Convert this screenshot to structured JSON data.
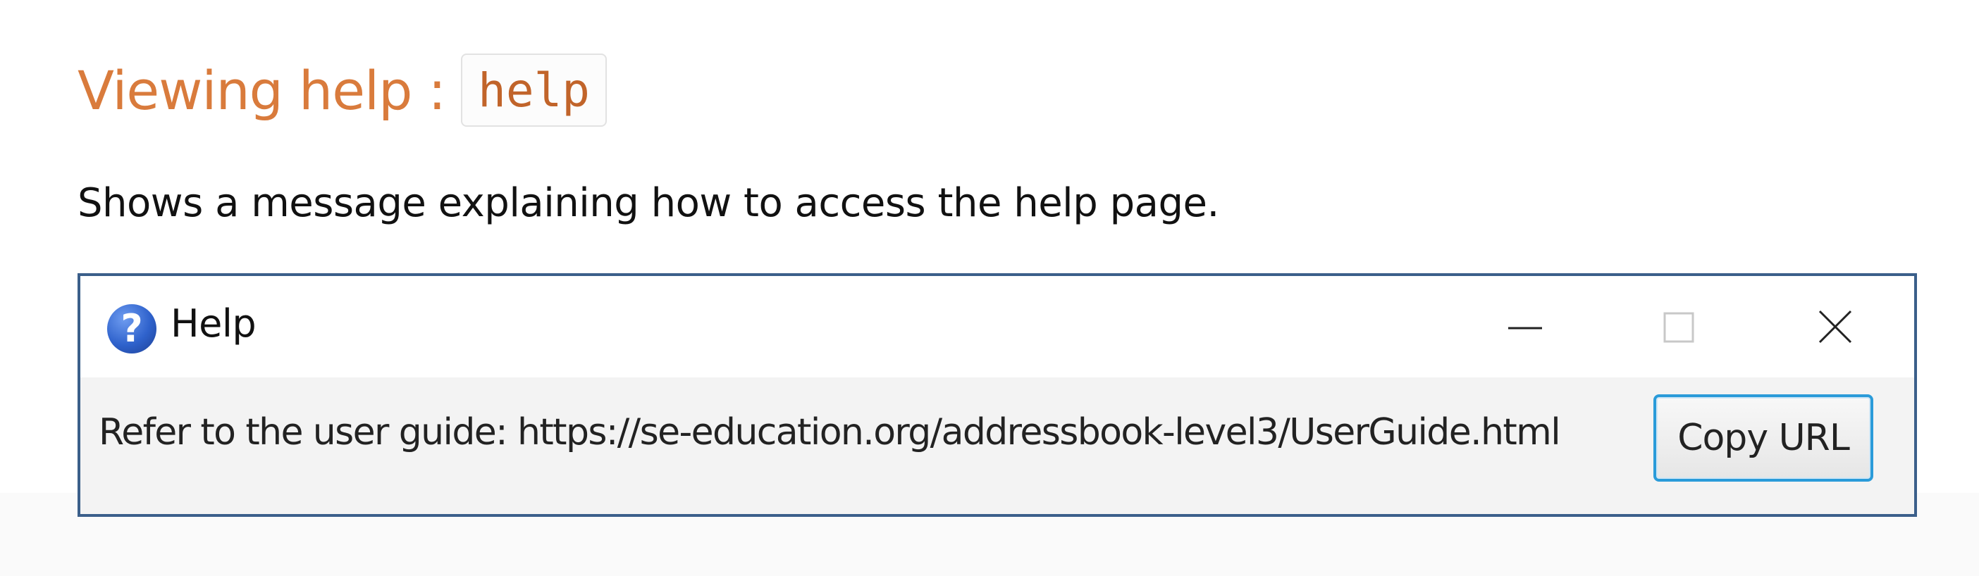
{
  "section": {
    "heading_text": "Viewing help :",
    "heading_code": "help",
    "description": "Shows a message explaining how to access the help page."
  },
  "help_window": {
    "title": "Help",
    "icon": "question-mark-icon",
    "controls": {
      "minimize": "minimize-icon",
      "maximize": "maximize-icon",
      "close": "close-icon"
    },
    "message": "Refer to the user guide: https://se-education.org/addressbook-level3/UserGuide.html",
    "copy_button_label": "Copy URL"
  },
  "colors": {
    "heading": "#d97b3c",
    "window_border": "#3b5f8a",
    "button_focus": "#2a9bd9"
  }
}
